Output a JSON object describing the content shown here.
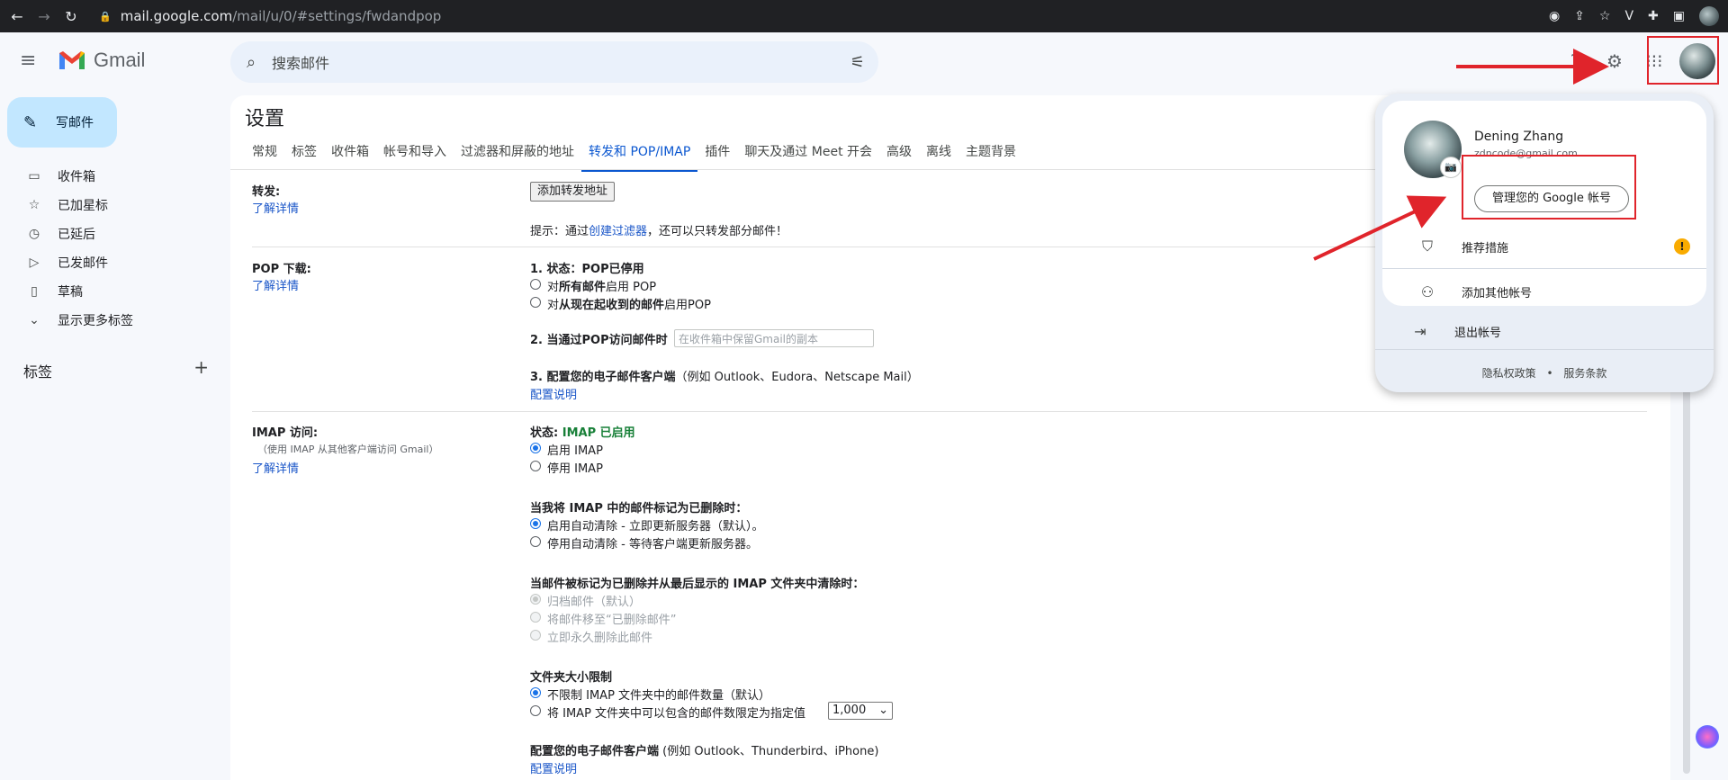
{
  "browser": {
    "url_host": "mail.google.com",
    "url_path": "/mail/u/0/#settings/fwdandpop"
  },
  "gmail": {
    "brand": "Gmail",
    "search_placeholder": "搜索邮件"
  },
  "sidebar": {
    "compose": "写邮件",
    "items": [
      {
        "label": "收件箱",
        "icon": "inbox-icon"
      },
      {
        "label": "已加星标",
        "icon": "star-icon"
      },
      {
        "label": "已延后",
        "icon": "clock-icon"
      },
      {
        "label": "已发邮件",
        "icon": "send-icon"
      },
      {
        "label": "草稿",
        "icon": "draft-icon"
      },
      {
        "label": "显示更多标签",
        "icon": "chevron-down-icon"
      }
    ],
    "labels_header": "标签"
  },
  "settings": {
    "title": "设置",
    "tabs": [
      "常规",
      "标签",
      "收件箱",
      "帐号和导入",
      "过滤器和屏蔽的地址",
      "转发和 POP/IMAP",
      "插件",
      "聊天及通过 Meet 开会",
      "高级",
      "离线",
      "主题背景"
    ],
    "active_tab": "转发和 POP/IMAP",
    "learn_more": "了解详情",
    "forwarding": {
      "label": "转发:",
      "add_button": "添加转发地址",
      "hint_prefix": "提示：通过",
      "hint_link": "创建过滤器",
      "hint_suffix": "，还可以只转发部分邮件！"
    },
    "pop": {
      "label": "POP 下载:",
      "status_prefix": "1. 状态：",
      "status_value": "POP已停用",
      "opt1_a": "对",
      "opt1_b": "所有邮件",
      "opt1_c": "启用 POP",
      "opt2_a": "对",
      "opt2_b": "从现在起收到的邮件",
      "opt2_c": "启用POP",
      "when_label": "2. 当通过POP访问邮件时",
      "when_select": "在收件箱中保留Gmail的副本",
      "config_label": "3. 配置您的电子邮件客户端",
      "config_hint": "（例如 Outlook、Eudora、Netscape Mail）",
      "config_link": "配置说明"
    },
    "imap": {
      "label": "IMAP 访问:",
      "sublabel": "（使用 IMAP 从其他客户端访问 Gmail）",
      "status_prefix": "状态: ",
      "status_value": "IMAP 已启用",
      "enable": "启用 IMAP",
      "disable": "停用 IMAP",
      "deleted_label": "当我将 IMAP 中的邮件标记为已删除时：",
      "auto_on": "启用自动清除 - 立即更新服务器（默认）。",
      "auto_off": "停用自动清除 - 等待客户端更新服务器。",
      "expunge_label": "当邮件被标记为已删除并从最后显示的 IMAP 文件夹中清除时：",
      "archive": "归档邮件（默认）",
      "trash": "将邮件移至“已删除邮件”",
      "delete_forever": "立即永久删除此邮件",
      "folder_label": "文件夹大小限制",
      "no_limit": "不限制 IMAP 文件夹中的邮件数量（默认）",
      "limit": "将 IMAP 文件夹中可以包含的邮件数限定为指定值",
      "limit_value": "1,000",
      "client_label": "配置您的电子邮件客户端",
      "client_hint": "(例如 Outlook、Thunderbird、iPhone)",
      "client_link": "配置说明"
    }
  },
  "account": {
    "name": "Dening Zhang",
    "email": "zdncode@gmail.com",
    "manage": "管理您的 Google 帐号",
    "recommended": "推荐措施",
    "add_account": "添加其他帐号",
    "sign_out": "退出帐号",
    "privacy": "隐私权政策",
    "dot": "•",
    "terms": "服务条款",
    "warn_symbol": "!"
  },
  "colors": {
    "accent": "#0b57d0",
    "annotation": "#e0242b",
    "imap_status": "#188038"
  }
}
